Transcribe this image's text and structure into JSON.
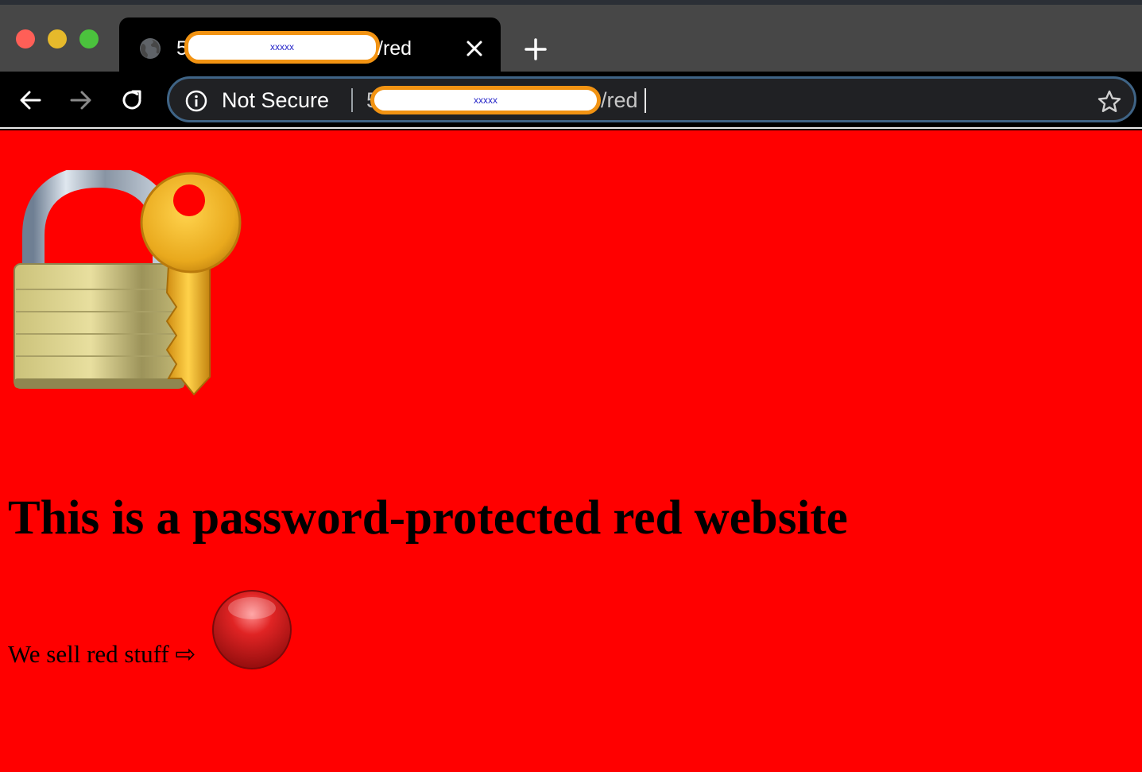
{
  "window": {
    "controls": [
      "close",
      "minimize",
      "zoom"
    ]
  },
  "tab": {
    "favicon": "globe-icon",
    "title_prefix": "5",
    "title_redacted": "xxxxx",
    "title_suffix": "/red",
    "close_icon": "close-icon"
  },
  "new_tab_icon": "plus-icon",
  "toolbar": {
    "back_icon": "arrow-left-icon",
    "forward_icon": "arrow-right-icon",
    "reload_icon": "reload-icon",
    "security_icon": "info-icon",
    "security_label": "Not Secure",
    "url_prefix": "5",
    "url_redacted": "xxxxx",
    "url_suffix": "/red",
    "bookmark_icon": "star-icon"
  },
  "page": {
    "background_color": "#ff0000",
    "hero_emoji": "locked-with-key",
    "heading": "This is a password-protected red website",
    "tagline": "We sell red stuff ⇨",
    "tagline_emoji": "red-circle"
  },
  "colors": {
    "redaction_border": "#f29312",
    "omnibox_border": "#3f6486"
  }
}
